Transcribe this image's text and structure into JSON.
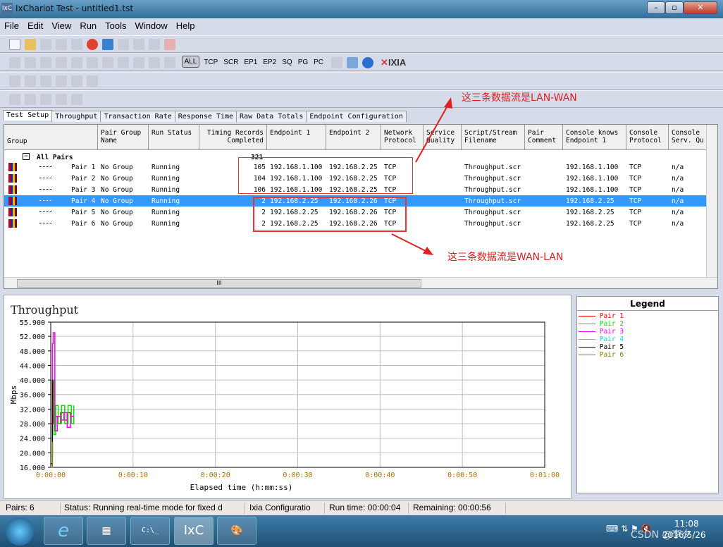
{
  "window": {
    "title": "IxChariot Test - untitled1.tst",
    "app_icon": "IxC"
  },
  "menu": [
    "File",
    "Edit",
    "View",
    "Run",
    "Tools",
    "Window",
    "Help"
  ],
  "toolbar": {
    "filters": [
      "ALL",
      "TCP",
      "SCR",
      "EP1",
      "EP2",
      "SQ",
      "PG",
      "PC"
    ],
    "brand": "IXIA"
  },
  "tabs": [
    "Test Setup",
    "Throughput",
    "Transaction Rate",
    "Response Time",
    "Raw Data Totals",
    "Endpoint Configuration"
  ],
  "grid": {
    "headers": [
      "Group",
      "Pair Group Name",
      "Run Status",
      "Timing Records Completed",
      "Endpoint 1",
      "Endpoint 2",
      "Network Protocol",
      "Service Quality",
      "Script/Stream Filename",
      "Pair Comment",
      "Console knows Endpoint 1",
      "Console Protocol",
      "Console Serv. Qu"
    ],
    "group": {
      "label": "All Pairs",
      "total": "321"
    },
    "rows": [
      {
        "pair": "Pair 1",
        "group": "No Group",
        "status": "Running",
        "records": "105",
        "ep1": "192.168.1.100",
        "ep2": "192.168.2.25",
        "proto": "TCP",
        "script": "Throughput.scr",
        "console_ep1": "192.168.1.100",
        "console_proto": "TCP",
        "serv": "n/a"
      },
      {
        "pair": "Pair 2",
        "group": "No Group",
        "status": "Running",
        "records": "104",
        "ep1": "192.168.1.100",
        "ep2": "192.168.2.25",
        "proto": "TCP",
        "script": "Throughput.scr",
        "console_ep1": "192.168.1.100",
        "console_proto": "TCP",
        "serv": "n/a"
      },
      {
        "pair": "Pair 3",
        "group": "No Group",
        "status": "Running",
        "records": "106",
        "ep1": "192.168.1.100",
        "ep2": "192.168.2.25",
        "proto": "TCP",
        "script": "Throughput.scr",
        "console_ep1": "192.168.1.100",
        "console_proto": "TCP",
        "serv": "n/a"
      },
      {
        "pair": "Pair 4",
        "group": "No Group",
        "status": "Running",
        "records": "2",
        "ep1": "192.168.2.25",
        "ep2": "192.168.2.26",
        "proto": "TCP",
        "script": "Throughput.scr",
        "console_ep1": "192.168.2.25",
        "console_proto": "TCP",
        "serv": "n/a"
      },
      {
        "pair": "Pair 5",
        "group": "No Group",
        "status": "Running",
        "records": "2",
        "ep1": "192.168.2.25",
        "ep2": "192.168.2.26",
        "proto": "TCP",
        "script": "Throughput.scr",
        "console_ep1": "192.168.2.25",
        "console_proto": "TCP",
        "serv": "n/a"
      },
      {
        "pair": "Pair 6",
        "group": "No Group",
        "status": "Running",
        "records": "2",
        "ep1": "192.168.2.25",
        "ep2": "192.168.2.26",
        "proto": "TCP",
        "script": "Throughput.scr",
        "console_ep1": "192.168.2.25",
        "console_proto": "TCP",
        "serv": "n/a"
      }
    ],
    "selected_row": 3,
    "scroll_mark": "III"
  },
  "annotations": {
    "lan_wan": "这三条数据流是LAN-WAN",
    "wan_lan": "这三条数据流是WAN-LAN",
    "color": "#e02020"
  },
  "chart_data": {
    "type": "line",
    "title": "Throughput",
    "xlabel": "Elapsed time (h:mm:ss)",
    "ylabel": "Mbps",
    "ylim": [
      16,
      55.9
    ],
    "yticks": [
      "55.900",
      "52.000",
      "48.000",
      "44.000",
      "40.000",
      "36.000",
      "32.000",
      "28.000",
      "24.000",
      "20.000",
      "16.000"
    ],
    "xlim": [
      0,
      60
    ],
    "xticks": [
      "0:00:00",
      "0:00:10",
      "0:00:20",
      "0:00:30",
      "0:00:40",
      "0:00:50",
      "0:01:00"
    ],
    "grid": true,
    "legend_title": "Legend",
    "legend_position": "right",
    "series": [
      {
        "name": "Pair 1",
        "color": "#ff0000",
        "x": [
          0,
          0.3,
          0.5,
          0.8,
          1.2,
          1.6,
          2,
          2.4,
          2.8
        ],
        "y": [
          28,
          40,
          30,
          28,
          31,
          29,
          31,
          30,
          30
        ]
      },
      {
        "name": "Pair 2",
        "color": "#00e000",
        "x": [
          0,
          0.2,
          0.4,
          0.6,
          0.9,
          1.3,
          1.7,
          2.1,
          2.5,
          2.8
        ],
        "y": [
          19,
          40,
          25,
          33,
          28,
          33,
          28,
          33,
          28,
          33
        ]
      },
      {
        "name": "Pair 3",
        "color": "#ff00ff",
        "x": [
          0,
          0.2,
          0.3,
          0.5,
          0.8,
          1.2,
          1.6,
          2,
          2.4,
          2.8
        ],
        "y": [
          28,
          50,
          53,
          26,
          30,
          29,
          31,
          27,
          30,
          30
        ]
      },
      {
        "name": "Pair 4",
        "color": "#00e0e0",
        "x": [
          0,
          0.2
        ],
        "y": [
          30,
          30
        ]
      },
      {
        "name": "Pair 5",
        "color": "#000000",
        "x": [
          0,
          0.2
        ],
        "y": [
          17,
          40
        ]
      },
      {
        "name": "Pair 6",
        "color": "#808000",
        "x": [
          0,
          0.2
        ],
        "y": [
          16,
          23
        ]
      }
    ]
  },
  "status": {
    "pairs": "Pairs: 6",
    "status": "Status: Running real-time mode for fixed d",
    "config": "Ixia Configuratio",
    "runtime": "Run time: 00:00:04",
    "remaining": "Remaining: 00:00:56"
  },
  "taskbar": {
    "time": "11:08",
    "date": "2016/5/26",
    "watermark": "CSDN @李夕"
  }
}
